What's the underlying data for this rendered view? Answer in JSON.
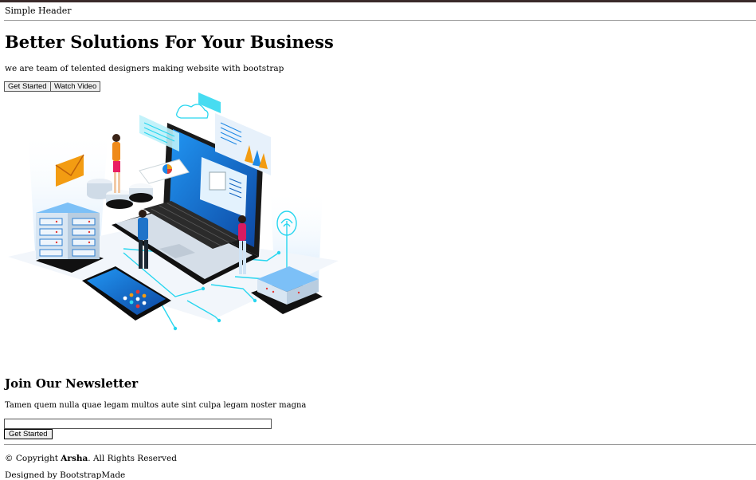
{
  "header": {
    "title": "Simple Header"
  },
  "hero": {
    "heading": "Better Solutions For Your Business",
    "tagline": "we are team of telented designers making website with bootstrap",
    "primary_button": "Get Started",
    "secondary_button": "Watch Video",
    "illustration": "isometric-laptop-devices-illustration"
  },
  "newsletter": {
    "heading": "Join Our Newsletter",
    "description": "Tamen quem nulla quae legam multos aute sint culpa legam noster magna",
    "input_value": "",
    "button": "Get Started"
  },
  "footer": {
    "copyright_prefix": "© Copyright ",
    "brand": "Arsha",
    "copyright_suffix": ". All Rights Reserved",
    "credits": "Designed by BootstrapMade"
  },
  "colors": {
    "accent_blue": "#1e88e5",
    "cyan": "#27d6ef",
    "topbar": "#3a2a2a"
  }
}
